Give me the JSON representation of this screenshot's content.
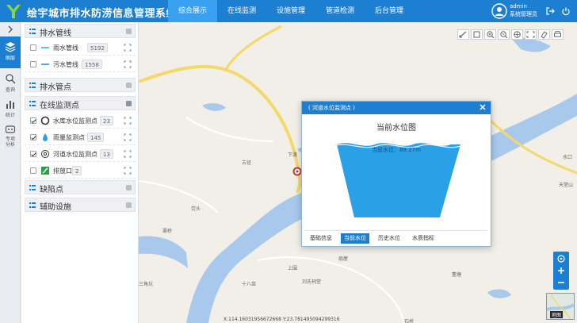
{
  "header": {
    "title": "绘宇城市排水防涝信息管理系统",
    "nav": [
      {
        "label": "综合展示",
        "active": true
      },
      {
        "label": "在线监测",
        "active": false
      },
      {
        "label": "设施管理",
        "active": false
      },
      {
        "label": "管道检测",
        "active": false
      },
      {
        "label": "后台管理",
        "active": false
      }
    ],
    "user": {
      "name": "admin",
      "role": "系统管理员"
    },
    "colors": {
      "primary": "#1d7fd1",
      "active_tab": "#3aa1f0"
    }
  },
  "rail": {
    "items": [
      {
        "label": "图层",
        "icon": "layers-icon",
        "active": true
      },
      {
        "label": "查询",
        "icon": "search-icon",
        "active": false
      },
      {
        "label": "统计",
        "icon": "bar-chart-icon",
        "active": false
      },
      {
        "label": "专项分析",
        "icon": "analysis-icon",
        "active": false
      }
    ]
  },
  "layers": {
    "drainage_pipes": {
      "title": "排水管线",
      "items": [
        {
          "label": "雨水管线",
          "count": "5192",
          "checked": false,
          "color": "#36b6e6"
        },
        {
          "label": "污水管线",
          "count": "1558",
          "checked": false,
          "color": "#3b8fd1"
        }
      ]
    },
    "drainage_points": {
      "title": "排水管点"
    },
    "monitoring_points": {
      "title": "在线监测点",
      "items": [
        {
          "label": "水库水位监测点",
          "count": "23",
          "checked": true,
          "icon": "reservoir-icon"
        },
        {
          "label": "雨量监测点",
          "count": "145",
          "checked": true,
          "icon": "rain-gauge-icon"
        },
        {
          "label": "河道水位监测点",
          "count": "13",
          "checked": true,
          "icon": "river-level-icon"
        },
        {
          "label": "排放口",
          "count": "2",
          "checked": false,
          "icon": "outfall-icon"
        }
      ]
    },
    "defect_points": {
      "title": "缺陷点"
    },
    "aux_facilities": {
      "title": "辅助设施"
    }
  },
  "map": {
    "labels": [
      "下渡",
      "古径",
      "劳头",
      "渠桥",
      "上围",
      "十八亩",
      "刘氏祠堂",
      "扇屋",
      "董塘",
      "三角坑",
      "天堂山",
      "水口",
      "石桥"
    ],
    "coords": "X:114.16031956672668    Y:23.781495094299316",
    "basemap_label": "地图",
    "colors": {
      "water": "#a9c9ec",
      "land": "#f1efe8",
      "road": "#f7dc6f"
    }
  },
  "popup": {
    "title": "( 河道水位监测点 )",
    "chart_title": "当前水位图",
    "level_text": "当前水位：88.27m",
    "water_color": "#2aa0e6",
    "tabs": [
      {
        "label": "基础信息",
        "active": false
      },
      {
        "label": "当前水位",
        "active": true
      },
      {
        "label": "历史水位",
        "active": false
      },
      {
        "label": "水质指标",
        "active": false
      }
    ]
  }
}
